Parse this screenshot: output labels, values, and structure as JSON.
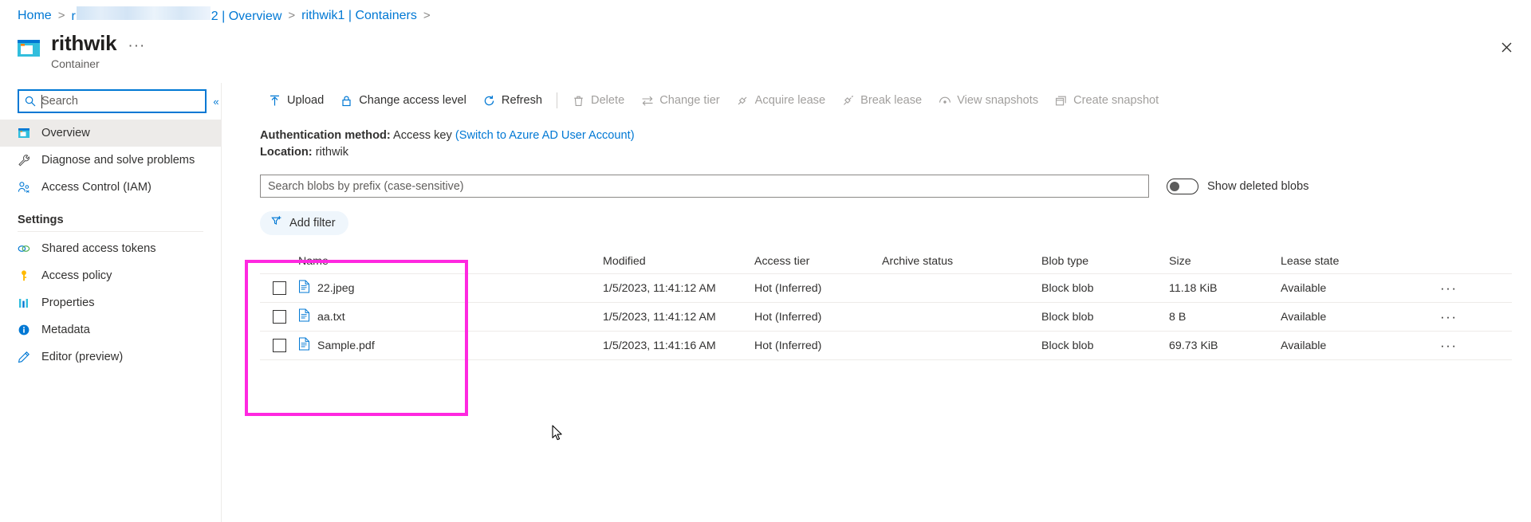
{
  "breadcrumb": {
    "items": [
      {
        "label": "Home",
        "redacted": false
      },
      {
        "label": "r",
        "redacted": true,
        "suffix": "2 | Overview"
      },
      {
        "label": "rithwik1 | Containers",
        "redacted": false
      }
    ],
    "separator": ">"
  },
  "header": {
    "title": "rithwik",
    "subtitle": "Container",
    "ellipsis": "···",
    "close_icon": "close-icon",
    "resource_icon": "container-icon"
  },
  "sidebar": {
    "search": {
      "value": "",
      "placeholder": "Search",
      "icon": "search-icon"
    },
    "collapse_icon": "«",
    "items": [
      {
        "label": "Overview",
        "icon": "overview-icon",
        "selected": true
      },
      {
        "label": "Diagnose and solve problems",
        "icon": "wrench-icon",
        "selected": false
      },
      {
        "label": "Access Control (IAM)",
        "icon": "people-icon",
        "selected": false
      }
    ],
    "group_label": "Settings",
    "settings_items": [
      {
        "label": "Shared access tokens",
        "icon": "link-icon",
        "selected": false
      },
      {
        "label": "Access policy",
        "icon": "key-icon",
        "selected": false
      },
      {
        "label": "Properties",
        "icon": "bars-icon",
        "selected": false
      },
      {
        "label": "Metadata",
        "icon": "info-icon",
        "selected": false
      },
      {
        "label": "Editor (preview)",
        "icon": "pencil-icon",
        "selected": false
      }
    ]
  },
  "toolbar": {
    "commands": [
      {
        "label": "Upload",
        "icon": "upload-icon",
        "disabled": false
      },
      {
        "label": "Change access level",
        "icon": "lock-icon",
        "disabled": false
      },
      {
        "label": "Refresh",
        "icon": "refresh-icon",
        "disabled": false
      },
      {
        "label": "Delete",
        "icon": "trash-icon",
        "disabled": true
      },
      {
        "label": "Change tier",
        "icon": "swap-icon",
        "disabled": true
      },
      {
        "label": "Acquire lease",
        "icon": "plug-icon",
        "disabled": true
      },
      {
        "label": "Break lease",
        "icon": "plug-break-icon",
        "disabled": true
      },
      {
        "label": "View snapshots",
        "icon": "snapshot-icon",
        "disabled": true
      },
      {
        "label": "Create snapshot",
        "icon": "create-snapshot-icon",
        "disabled": true
      }
    ]
  },
  "info": {
    "auth_label": "Authentication method:",
    "auth_value": "Access key",
    "auth_link": "(Switch to Azure AD User Account)",
    "location_label": "Location:",
    "location_value": "rithwik"
  },
  "filters": {
    "search_placeholder": "Search blobs by prefix (case-sensitive)",
    "search_value": "",
    "toggle_label": "Show deleted blobs",
    "toggle_on": false,
    "add_filter_label": "Add filter",
    "add_filter_icon": "add-filter-icon"
  },
  "table": {
    "columns": [
      "Name",
      "Modified",
      "Access tier",
      "Archive status",
      "Blob type",
      "Size",
      "Lease state"
    ],
    "rows": [
      {
        "name": "22.jpeg",
        "icon": "file-icon",
        "checked": false,
        "modified": "1/5/2023, 11:41:12 AM",
        "access_tier": "Hot (Inferred)",
        "archive_status": "",
        "blob_type": "Block blob",
        "size": "11.18 KiB",
        "lease_state": "Available",
        "menu": "···"
      },
      {
        "name": "aa.txt",
        "icon": "file-icon",
        "checked": false,
        "modified": "1/5/2023, 11:41:12 AM",
        "access_tier": "Hot (Inferred)",
        "archive_status": "",
        "blob_type": "Block blob",
        "size": "8 B",
        "lease_state": "Available",
        "menu": "···"
      },
      {
        "name": "Sample.pdf",
        "icon": "file-icon",
        "checked": false,
        "modified": "1/5/2023, 11:41:16 AM",
        "access_tier": "Hot (Inferred)",
        "archive_status": "",
        "blob_type": "Block blob",
        "size": "69.73 KiB",
        "lease_state": "Available",
        "menu": "···"
      }
    ]
  },
  "annotation": {
    "color": "#ff28e0",
    "target": "name-column-highlight"
  },
  "colors": {
    "accent": "#0078d4",
    "selected_nav": "#edebe9",
    "annotation": "#ff28e0"
  }
}
